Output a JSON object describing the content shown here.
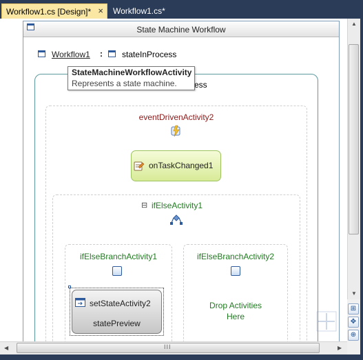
{
  "tabs": [
    {
      "label": "Workflow1.cs [Design]*",
      "active": true
    },
    {
      "label": "Workflow1.cs*",
      "active": false
    }
  ],
  "tab_close_glyph": "×",
  "workflow": {
    "title": "State Machine Workflow",
    "breadcrumb_root": "Workflow1",
    "breadcrumb_separator": ":",
    "breadcrumb_state": "stateInProcess",
    "state_title_partial": "ess"
  },
  "tooltip": {
    "title": "StateMachineWorkflowActivity",
    "description": "Represents a state machine."
  },
  "activities": {
    "event_driven": "eventDrivenActivity2",
    "on_task_changed": "onTaskChanged1",
    "if_else": "ifElseActivity1",
    "branch1": "ifElseBranchActivity1",
    "branch2": "ifElseBranchActivity2",
    "set_state": "setStateActivity2",
    "set_state_target": "statePreview",
    "drop_hint_line1": "Drop Activities",
    "drop_hint_line2": "Here"
  },
  "collapse_glyph": "⊟",
  "scroll": {
    "h_thumb_grip": "III"
  },
  "colors": {
    "tab_active": "#f9e7a3",
    "chrome": "#2b3c59",
    "connector_red": "#8b1a1a",
    "connector_green": "#217a21"
  },
  "icons": [
    "window-icon",
    "event-icon",
    "handle-external-event-icon",
    "ifelse-icon",
    "branch-icon",
    "set-state-icon",
    "zoom-icon",
    "pan-icon",
    "magnifier-icon"
  ]
}
